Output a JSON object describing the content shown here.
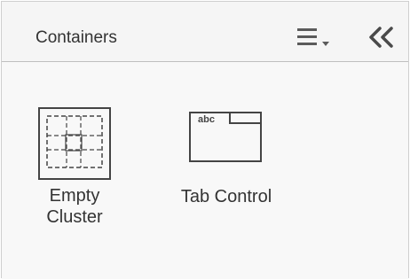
{
  "panel": {
    "title": "Containers"
  },
  "toolbar": {
    "menu_icon": "view-menu-icon",
    "collapse_icon": "collapse-left-icon"
  },
  "items": [
    {
      "label": "Empty\nCluster",
      "icon": "empty-cluster-icon"
    },
    {
      "label": "Tab Control",
      "icon": "tab-control-icon",
      "icon_text": "abc"
    }
  ],
  "colors": {
    "text": "#333333",
    "icon": "#444444",
    "panel_background": "#f8f8f8",
    "divider": "#bfbfbf"
  }
}
